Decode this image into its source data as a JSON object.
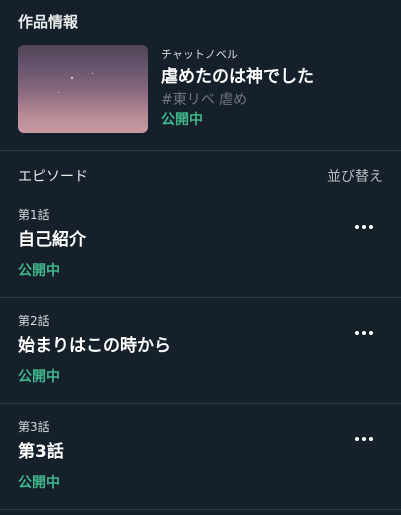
{
  "work_info": {
    "section_title": "作品情報",
    "category": "チャットノベル",
    "title": "虐めたのは神でした",
    "tags": "#東リベ 虐め",
    "status": "公開中"
  },
  "episodes": {
    "section_title": "エピソード",
    "sort_label": "並び替え",
    "items": [
      {
        "number": "第1話",
        "title": "自己紹介",
        "status": "公開中"
      },
      {
        "number": "第2話",
        "title": "始まりはこの時から",
        "status": "公開中"
      },
      {
        "number": "第3話",
        "title": "第3話",
        "status": "公開中"
      }
    ]
  },
  "icons": {
    "more": "more-horizontal-icon"
  },
  "colors": {
    "background": "#15202b",
    "status_green": "#3fb68b",
    "divider": "#2f3b47"
  }
}
